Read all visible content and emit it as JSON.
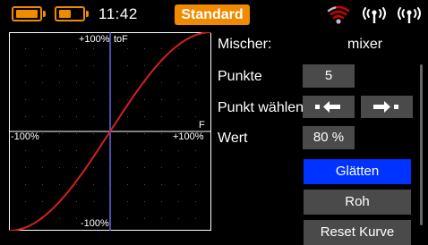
{
  "status": {
    "time": "11:42",
    "model_name": "Standard",
    "accent_color": "#f08a00",
    "icons": [
      "battery-icon",
      "battery-icon",
      "wifi-signal-icon",
      "antenna-icon",
      "antenna-icon"
    ]
  },
  "graph": {
    "top_label": "+100%",
    "top_right_label": "toF",
    "left_label": "-100%",
    "right_label": "+100%",
    "right_marker": "F",
    "bottom_label": "-100%",
    "curve_color": "#d42020",
    "axis_color": "#6a6aff"
  },
  "panel": {
    "mixer_label": "Mischer:",
    "mixer_value": "mixer",
    "points_label": "Punkte",
    "points_value": "5",
    "select_label": "Punkt wählen",
    "value_label": "Wert",
    "value_value": "80 %",
    "smooth_label": "Glätten",
    "raw_label": "Roh",
    "reset_label": "Reset Kurve",
    "active_color": "#0033ff",
    "button_color": "#4a4a4a"
  }
}
